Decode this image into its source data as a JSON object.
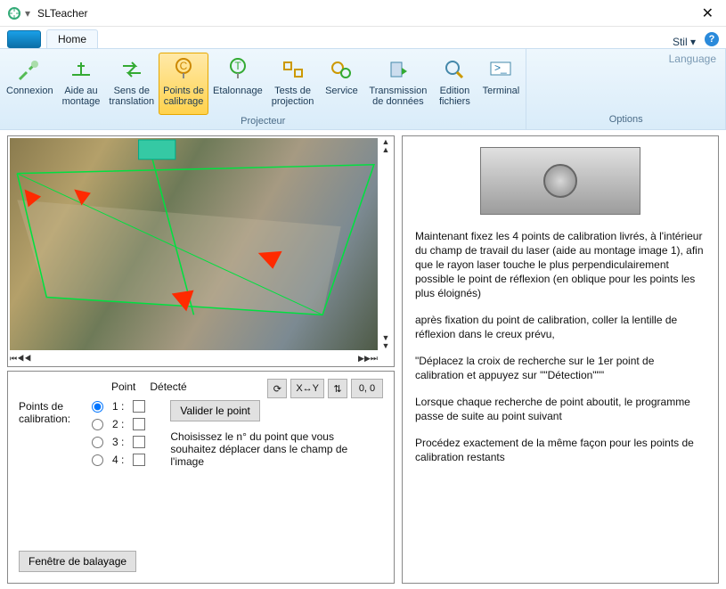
{
  "window": {
    "title": "SLTeacher",
    "close": "✕",
    "stil": "Stil"
  },
  "tabs": {
    "home": "Home"
  },
  "ribbon": {
    "connexion": "Connexion",
    "aide1": "Aide au",
    "aide2": "montage",
    "sens1": "Sens de",
    "sens2": "translation",
    "points1": "Points de",
    "points2": "calibrage",
    "etalonnage": "Etalonnage",
    "tests1": "Tests de",
    "tests2": "projection",
    "service": "Service",
    "trans1": "Transmission",
    "trans2": "de données",
    "edit1": "Edition",
    "edit2": "fichiers",
    "terminal": "Terminal",
    "group_projecteur": "Projecteur",
    "language": "Language",
    "options": "Options"
  },
  "controls": {
    "header_point": "Point",
    "header_detecte": "Détecté",
    "label_points1": "Points de",
    "label_points2": "calibration:",
    "pt1": "1 :",
    "pt2": "2 :",
    "pt3": "3 :",
    "pt4": "4 :",
    "validate": "Valider le point",
    "hint": "Choisissez le n° du point que vous souhaitez déplacer dans le champ de l'image",
    "scan": "Fenêtre de balayage",
    "btn_refresh": "⟳",
    "btn_xy": "X↔Y",
    "btn_swap": "⇅",
    "btn_zero": "0, 0"
  },
  "right": {
    "p1": "Maintenant fixez les 4 points de calibration livrés, à l'intérieur du champ de travail du laser (aide au montage image 1), afin",
    "p2": "que le rayon laser touche le plus perpendiculairement possible le point de réflexion (en oblique pour les points les plus éloignés)",
    "p3": "après fixation du point de calibration, coller la lentille de réflexion dans le creux prévu,",
    "p4": "\"Déplacez la croix de recherche sur le 1er point de calibration et appuyez sur \"\"Détection\"\"\"",
    "p5": "Lorsque chaque recherche de point aboutit, le programme passe de suite au point suivant",
    "p6": "Procédez exactement de la même façon pour les points de calibration restants"
  }
}
